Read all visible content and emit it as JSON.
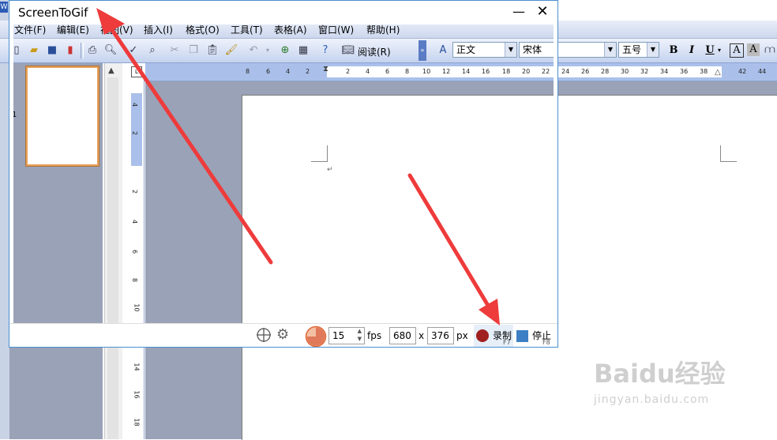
{
  "word": {
    "menu": [
      "文件(F)",
      "编辑(E)",
      "视图(V)",
      "插入(I)",
      "格式(O)",
      "工具(T)",
      "表格(A)",
      "窗口(W)",
      "帮助(H)"
    ],
    "toolbar": {
      "read_label": "阅读(R)",
      "style_value": "正文",
      "font_value": "宋体",
      "size_value": "五号",
      "bold": "B",
      "italic": "I",
      "underline": "U",
      "charborder": "A",
      "charshade": "A"
    },
    "thumbnail_number": "1",
    "h_ruler_numbers": [
      "8",
      "6",
      "4",
      "2",
      "2",
      "4",
      "6",
      "8",
      "10",
      "12",
      "14",
      "16",
      "18",
      "20",
      "22",
      "24",
      "26",
      "28",
      "30",
      "32",
      "34",
      "36",
      "38",
      "42",
      "44"
    ],
    "v_ruler_numbers": [
      "4",
      "2",
      "2",
      "4",
      "6",
      "8",
      "10",
      "14",
      "16",
      "18"
    ]
  },
  "screentogif": {
    "title": "ScreenToGif",
    "fps_value": "15",
    "fps_unit": "fps",
    "width_value": "680",
    "height_value": "376",
    "size_separator": "x",
    "size_unit": "px",
    "record_label": "录制",
    "record_shortcut": "F7",
    "stop_label": "停止",
    "stop_shortcut": "F8"
  },
  "watermark": {
    "brand": "Baidu经验",
    "url": "jingyan.baidu.com"
  },
  "colors": {
    "record_dot": "#a02020",
    "stop_square": "#3d7fc4",
    "arrow": "#ee3b3b",
    "window_border": "#4a8fd0"
  }
}
